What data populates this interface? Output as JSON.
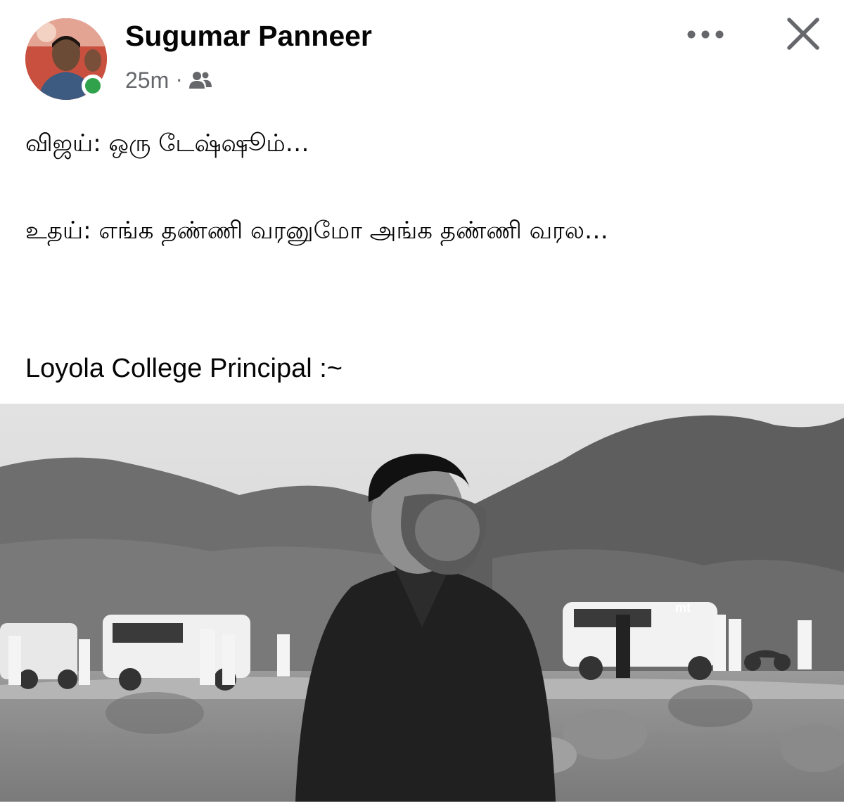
{
  "post": {
    "author": "Sugumar Panneer",
    "timestamp": "25m",
    "separator": "·",
    "audience_icon": "friends-icon",
    "more_icon": "more-icon",
    "close_icon": "close-icon",
    "status": "online",
    "status_color": "#31a24c"
  },
  "content": {
    "line1": "விஜய்: ஒரு டேஷ்ஷூம்…",
    "line2": "உதய்: எங்க தண்ணி வரனுமோ அங்க தண்ணி வரல…",
    "line3": "Loyola College Principal :~"
  },
  "image": {
    "watermark": "mt"
  }
}
